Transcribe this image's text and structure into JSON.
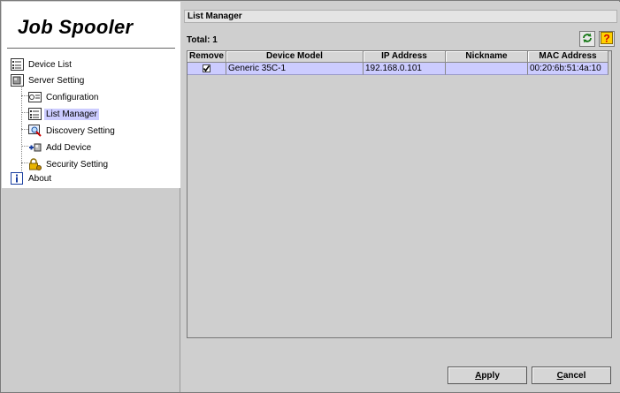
{
  "app": {
    "title": "Job Spooler"
  },
  "tree": {
    "device_list": "Device List",
    "server_setting": "Server Setting",
    "configuration": "Configuration",
    "list_manager": "List Manager",
    "discovery_setting": "Discovery Setting",
    "add_device": "Add Device",
    "security_setting": "Security Setting",
    "about": "About"
  },
  "panel": {
    "title": "List Manager",
    "total_label": "Total: 1"
  },
  "table": {
    "headers": [
      "Remove",
      "Device Model",
      "IP Address",
      "Nickname",
      "MAC Address"
    ],
    "rows": [
      {
        "remove": true,
        "device_model": "Generic 35C-1",
        "ip": "192.168.0.101",
        "nickname": "",
        "mac": "00:20:6b:51:4a:10"
      }
    ]
  },
  "buttons": {
    "apply": "Apply",
    "cancel": "Cancel"
  },
  "icons": {
    "refresh": "refresh-icon",
    "help": "help-icon"
  },
  "colors": {
    "selection": "#ccccff",
    "background": "#cfcfcf"
  }
}
